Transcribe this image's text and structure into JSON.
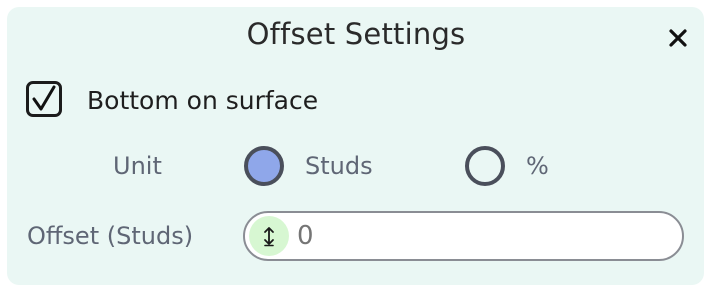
{
  "dialog": {
    "title": "Offset Settings",
    "close_icon": "close-icon"
  },
  "bottom_on_surface": {
    "label": "Bottom on surface",
    "checked": true,
    "icon": "checkmark-icon"
  },
  "unit": {
    "label": "Unit",
    "options": [
      {
        "label": "Studs",
        "selected": true
      },
      {
        "label": "%",
        "selected": false
      }
    ]
  },
  "offset": {
    "label": "Offset (Studs)",
    "value": "",
    "placeholder": "0",
    "handle_icon": "vertical-arrows-icon"
  },
  "colors": {
    "panel_bg": "#eaf7f4",
    "radio_selected": "#8fa7ea",
    "handle_bg": "#d7f7d2"
  }
}
